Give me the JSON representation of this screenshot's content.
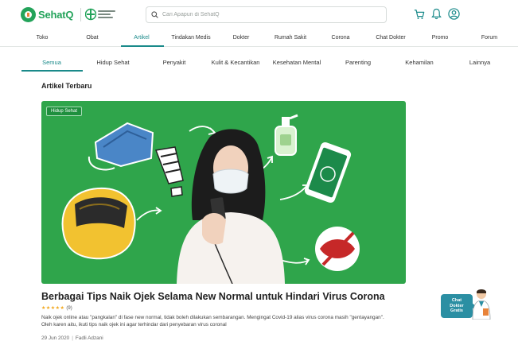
{
  "header": {
    "brand": "SehatQ",
    "search_placeholder": "Cari Apapun di SehatQ",
    "icons": [
      "cart-icon",
      "bell-icon",
      "user-icon"
    ]
  },
  "categories": [
    {
      "label": "Toko"
    },
    {
      "label": "Obat"
    },
    {
      "label": "Artikel",
      "active": true
    },
    {
      "label": "Tindakan Medis"
    },
    {
      "label": "Dokter"
    },
    {
      "label": "Rumah Sakit"
    },
    {
      "label": "Corona"
    },
    {
      "label": "Chat Dokter"
    },
    {
      "label": "Promo"
    },
    {
      "label": "Forum"
    }
  ],
  "subcategories": [
    {
      "label": "Semua",
      "active": true
    },
    {
      "label": "Hidup Sehat"
    },
    {
      "label": "Penyakit"
    },
    {
      "label": "Kulit & Kecantikan"
    },
    {
      "label": "Kesehatan Mental"
    },
    {
      "label": "Parenting"
    },
    {
      "label": "Kehamilan"
    },
    {
      "label": "Lainnya"
    }
  ],
  "section_title": "Artikel Terbaru",
  "article": {
    "tag": "Hidup Sehat",
    "title": "Berbagai Tips Naik Ojek Selama New Normal untuk Hindari Virus Corona",
    "stars": "★★★★★",
    "rating_count": "(9)",
    "excerpt": "Naik ojek online atau \"pangkalan\" di fase new normal, tidak boleh dilakukan sembarangan. Mengingat Covid-19 alias virus corona masih \"gentayangan\". Oleh karen aitu, ikuti tips naik ojek ini agar terhindar dari penyebaran virus coronal",
    "date": "29 Jun 2020",
    "author": "Fadli Adzani"
  },
  "chat_widget": {
    "line1": "Chat",
    "line2": "Dokter",
    "line3": "Gratis"
  },
  "colors": {
    "brand_green": "#23a35a",
    "accent_teal": "#1a8a8a",
    "hero_green": "#2fa54b",
    "star": "#f2a71b"
  }
}
